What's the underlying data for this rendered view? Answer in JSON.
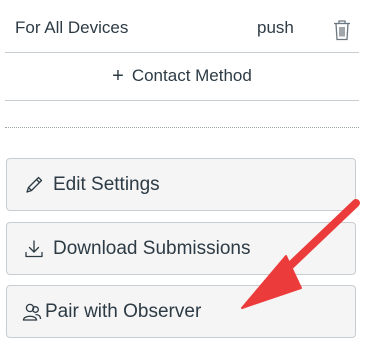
{
  "notifications": {
    "row": {
      "device": "For All Devices",
      "method": "push",
      "delete_icon": "trash-icon"
    },
    "add_contact_label": "Contact Method",
    "add_contact_icon": "plus-icon"
  },
  "sidebar_buttons": [
    {
      "label": "Edit Settings",
      "icon": "pencil-icon"
    },
    {
      "label": "Download Submissions",
      "icon": "download-icon"
    },
    {
      "label": "Pair with Observer",
      "icon": "users-icon"
    }
  ],
  "annotation": {
    "type": "arrow",
    "color": "#ec3b3b",
    "points_to": "Pair with Observer"
  },
  "colors": {
    "button_bg": "#f5f5f5",
    "border": "#c7cdd1",
    "text": "#2d3b45"
  }
}
